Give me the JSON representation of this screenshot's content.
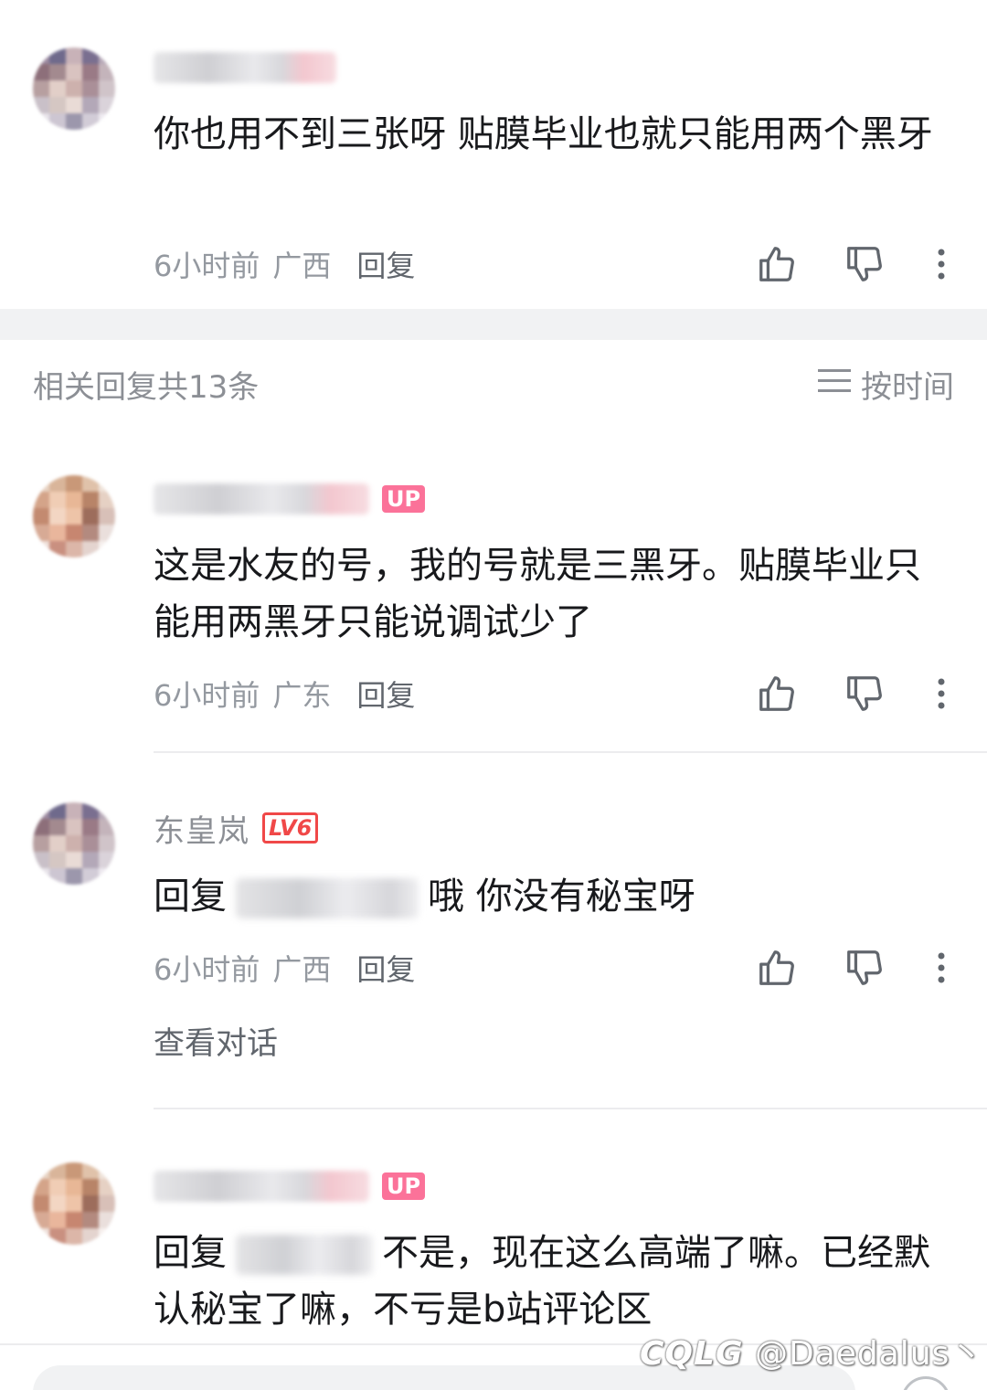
{
  "comments": [
    {
      "text": "你也用不到三张呀 贴膜毕业也就只能用两个黑牙",
      "time": "6小时前",
      "location": "广西",
      "reply_label": "回复"
    },
    {
      "badge": "UP",
      "text": "这是水友的号，我的号就是三黑牙。贴膜毕业只能用两黑牙只能说调试少了",
      "time": "6小时前",
      "location": "广东",
      "reply_label": "回复"
    },
    {
      "username": "东皇岚",
      "level_badge": "LV6",
      "reply_prefix": "回复",
      "text": "哦 你没有秘宝呀",
      "time": "6小时前",
      "location": "广西",
      "reply_label": "回复",
      "view_conversation": "查看对话"
    },
    {
      "badge": "UP",
      "reply_prefix": "回复",
      "text": "不是，现在这么高端了嘛。已经默认秘宝了嘛，不亏是b站评论区"
    }
  ],
  "section": {
    "title": "相关回复共13条",
    "sort_label": "按时间"
  },
  "watermark": "@Daedalus丶",
  "watermark_logo": "CQLG",
  "colors": {
    "accent_pink": "#fb7299",
    "level_red": "#f04848",
    "meta_gray": "#9499a0"
  },
  "icons": {
    "like": "thumbs-up-icon",
    "dislike": "thumbs-down-icon",
    "more": "more-vertical-icon",
    "sort": "sort-lines-icon"
  }
}
